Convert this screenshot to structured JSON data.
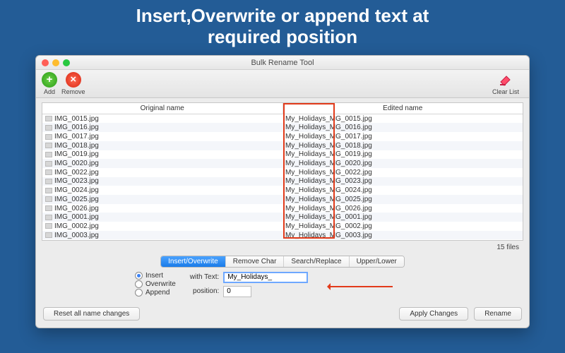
{
  "promo": {
    "line1": "Insert,Overwrite or append text at",
    "line2": "required position"
  },
  "window": {
    "title": "Bulk Rename Tool"
  },
  "toolbar": {
    "add": "Add",
    "remove": "Remove",
    "clear": "Clear List"
  },
  "table": {
    "col_original": "Original name",
    "col_edited": "Edited name",
    "rows": [
      {
        "orig": "IMG_0015.jpg",
        "edit": "My_Holidays_MG_0015.jpg"
      },
      {
        "orig": "IMG_0016.jpg",
        "edit": "My_Holidays_MG_0016.jpg"
      },
      {
        "orig": "IMG_0017.jpg",
        "edit": "My_Holidays_MG_0017.jpg"
      },
      {
        "orig": "IMG_0018.jpg",
        "edit": "My_Holidays_MG_0018.jpg"
      },
      {
        "orig": "IMG_0019.jpg",
        "edit": "My_Holidays_MG_0019.jpg"
      },
      {
        "orig": "IMG_0020.jpg",
        "edit": "My_Holidays_MG_0020.jpg"
      },
      {
        "orig": "IMG_0022.jpg",
        "edit": "My_Holidays_MG_0022.jpg"
      },
      {
        "orig": "IMG_0023.jpg",
        "edit": "My_Holidays_MG_0023.jpg"
      },
      {
        "orig": "IMG_0024.jpg",
        "edit": "My_Holidays_MG_0024.jpg"
      },
      {
        "orig": "IMG_0025.jpg",
        "edit": "My_Holidays_MG_0025.jpg"
      },
      {
        "orig": "IMG_0026.jpg",
        "edit": "My_Holidays_MG_0026.jpg"
      },
      {
        "orig": "IMG_0001.jpg",
        "edit": "My_Holidays_MG_0001.jpg"
      },
      {
        "orig": "IMG_0002.jpg",
        "edit": "My_Holidays_MG_0002.jpg"
      },
      {
        "orig": "IMG_0003.jpg",
        "edit": "My_Holidays_MG_0003.jpg"
      }
    ],
    "count_label": "15 files"
  },
  "tabs": {
    "insert_overwrite": "Insert/Overwrite",
    "remove_char": "Remove Char",
    "search_replace": "Search/Replace",
    "upper_lower": "Upper/Lower"
  },
  "radios": {
    "insert": "Insert",
    "overwrite": "Overwrite",
    "append": "Append",
    "selected": "insert"
  },
  "fields": {
    "with_text_label": "with Text:",
    "with_text_value": "My_Holidays_",
    "position_label": "position:",
    "position_value": "0"
  },
  "buttons": {
    "reset": "Reset all name changes",
    "apply": "Apply Changes",
    "rename": "Rename"
  }
}
